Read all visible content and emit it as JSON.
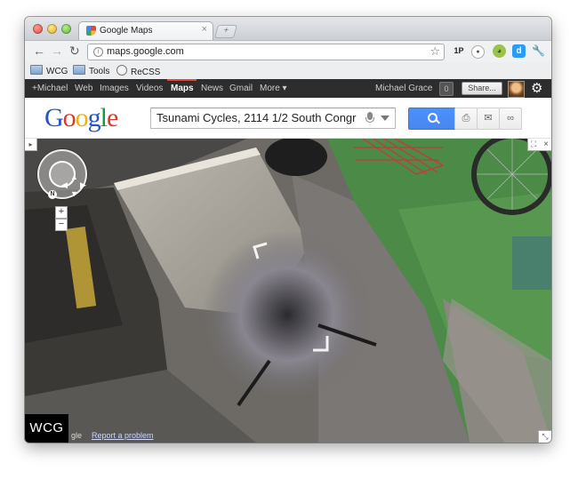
{
  "browser": {
    "tab": {
      "title": "Google Maps",
      "close_glyph": "×"
    },
    "newtab_glyph": "+",
    "nav": {
      "back_glyph": "←",
      "forward_glyph": "→",
      "reload_glyph": "↻"
    },
    "address": {
      "url": "maps.google.com",
      "page_icon": "i",
      "star_glyph": "☆"
    },
    "extensions": [
      {
        "name": "1password-icon",
        "label": "1P"
      },
      {
        "name": "record-icon",
        "label": "●"
      },
      {
        "name": "frog-icon",
        "label": "◕"
      },
      {
        "name": "d-extension-icon",
        "label": "d"
      },
      {
        "name": "wrench-icon",
        "label": "🔧"
      }
    ],
    "bookmarks": [
      {
        "label": "WCG",
        "icon": "folder-icon"
      },
      {
        "label": "Tools",
        "icon": "folder-icon"
      },
      {
        "label": "ReCSS",
        "icon": "globe-icon"
      }
    ]
  },
  "gbar": {
    "links": [
      "+Michael",
      "Web",
      "Images",
      "Videos",
      "Maps",
      "News",
      "Gmail",
      "More ▾"
    ],
    "active": "Maps",
    "user_name": "Michael Grace",
    "notification_count": "0",
    "share_label": "Share...",
    "gear_glyph": "⚙"
  },
  "search": {
    "logo_letters": [
      "G",
      "o",
      "o",
      "g",
      "l",
      "e"
    ],
    "query": "Tsunami Cycles, 2114 1/2 South Congr",
    "print_glyph": "⎙",
    "email_glyph": "✉",
    "link_glyph": "∞"
  },
  "streetview": {
    "panel_toggle_glyph": "▸",
    "nav_arrows": {
      "up": "▲",
      "down": "▼",
      "left": "◀",
      "right": "▶"
    },
    "north_label": "N",
    "zoom_in": "+",
    "zoom_out": "−",
    "expand_glyph": "⛶",
    "close_glyph": "×",
    "resize_glyph": "⤡",
    "copyright": "gle",
    "report_problem": "Report a problem"
  },
  "watermark": "WCG",
  "colors": {
    "gbar_bg": "#2d2d2d",
    "gbar_active": "#dd4b39",
    "search_blue": "#4d90fe"
  }
}
